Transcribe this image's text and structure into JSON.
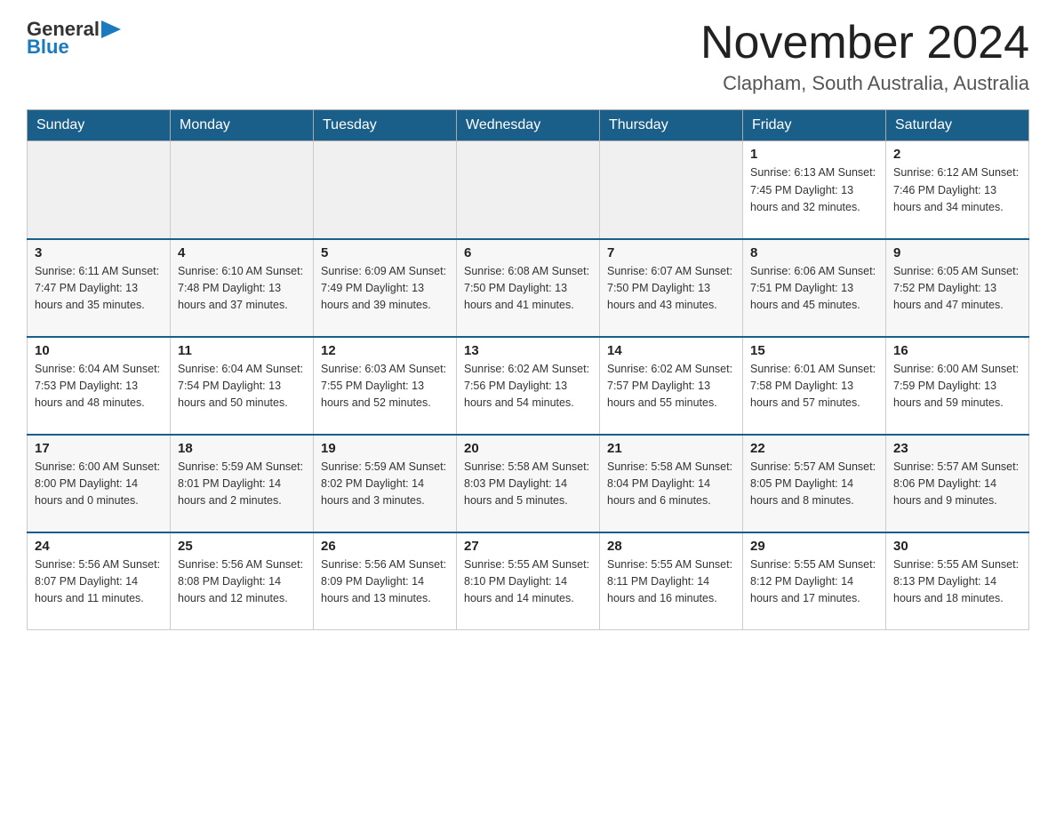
{
  "header": {
    "logo_general": "General",
    "logo_blue": "Blue",
    "title": "November 2024",
    "subtitle": "Clapham, South Australia, Australia"
  },
  "weekdays": [
    "Sunday",
    "Monday",
    "Tuesday",
    "Wednesday",
    "Thursday",
    "Friday",
    "Saturday"
  ],
  "weeks": [
    [
      {
        "day": "",
        "info": ""
      },
      {
        "day": "",
        "info": ""
      },
      {
        "day": "",
        "info": ""
      },
      {
        "day": "",
        "info": ""
      },
      {
        "day": "",
        "info": ""
      },
      {
        "day": "1",
        "info": "Sunrise: 6:13 AM\nSunset: 7:45 PM\nDaylight: 13 hours\nand 32 minutes."
      },
      {
        "day": "2",
        "info": "Sunrise: 6:12 AM\nSunset: 7:46 PM\nDaylight: 13 hours\nand 34 minutes."
      }
    ],
    [
      {
        "day": "3",
        "info": "Sunrise: 6:11 AM\nSunset: 7:47 PM\nDaylight: 13 hours\nand 35 minutes."
      },
      {
        "day": "4",
        "info": "Sunrise: 6:10 AM\nSunset: 7:48 PM\nDaylight: 13 hours\nand 37 minutes."
      },
      {
        "day": "5",
        "info": "Sunrise: 6:09 AM\nSunset: 7:49 PM\nDaylight: 13 hours\nand 39 minutes."
      },
      {
        "day": "6",
        "info": "Sunrise: 6:08 AM\nSunset: 7:50 PM\nDaylight: 13 hours\nand 41 minutes."
      },
      {
        "day": "7",
        "info": "Sunrise: 6:07 AM\nSunset: 7:50 PM\nDaylight: 13 hours\nand 43 minutes."
      },
      {
        "day": "8",
        "info": "Sunrise: 6:06 AM\nSunset: 7:51 PM\nDaylight: 13 hours\nand 45 minutes."
      },
      {
        "day": "9",
        "info": "Sunrise: 6:05 AM\nSunset: 7:52 PM\nDaylight: 13 hours\nand 47 minutes."
      }
    ],
    [
      {
        "day": "10",
        "info": "Sunrise: 6:04 AM\nSunset: 7:53 PM\nDaylight: 13 hours\nand 48 minutes."
      },
      {
        "day": "11",
        "info": "Sunrise: 6:04 AM\nSunset: 7:54 PM\nDaylight: 13 hours\nand 50 minutes."
      },
      {
        "day": "12",
        "info": "Sunrise: 6:03 AM\nSunset: 7:55 PM\nDaylight: 13 hours\nand 52 minutes."
      },
      {
        "day": "13",
        "info": "Sunrise: 6:02 AM\nSunset: 7:56 PM\nDaylight: 13 hours\nand 54 minutes."
      },
      {
        "day": "14",
        "info": "Sunrise: 6:02 AM\nSunset: 7:57 PM\nDaylight: 13 hours\nand 55 minutes."
      },
      {
        "day": "15",
        "info": "Sunrise: 6:01 AM\nSunset: 7:58 PM\nDaylight: 13 hours\nand 57 minutes."
      },
      {
        "day": "16",
        "info": "Sunrise: 6:00 AM\nSunset: 7:59 PM\nDaylight: 13 hours\nand 59 minutes."
      }
    ],
    [
      {
        "day": "17",
        "info": "Sunrise: 6:00 AM\nSunset: 8:00 PM\nDaylight: 14 hours\nand 0 minutes."
      },
      {
        "day": "18",
        "info": "Sunrise: 5:59 AM\nSunset: 8:01 PM\nDaylight: 14 hours\nand 2 minutes."
      },
      {
        "day": "19",
        "info": "Sunrise: 5:59 AM\nSunset: 8:02 PM\nDaylight: 14 hours\nand 3 minutes."
      },
      {
        "day": "20",
        "info": "Sunrise: 5:58 AM\nSunset: 8:03 PM\nDaylight: 14 hours\nand 5 minutes."
      },
      {
        "day": "21",
        "info": "Sunrise: 5:58 AM\nSunset: 8:04 PM\nDaylight: 14 hours\nand 6 minutes."
      },
      {
        "day": "22",
        "info": "Sunrise: 5:57 AM\nSunset: 8:05 PM\nDaylight: 14 hours\nand 8 minutes."
      },
      {
        "day": "23",
        "info": "Sunrise: 5:57 AM\nSunset: 8:06 PM\nDaylight: 14 hours\nand 9 minutes."
      }
    ],
    [
      {
        "day": "24",
        "info": "Sunrise: 5:56 AM\nSunset: 8:07 PM\nDaylight: 14 hours\nand 11 minutes."
      },
      {
        "day": "25",
        "info": "Sunrise: 5:56 AM\nSunset: 8:08 PM\nDaylight: 14 hours\nand 12 minutes."
      },
      {
        "day": "26",
        "info": "Sunrise: 5:56 AM\nSunset: 8:09 PM\nDaylight: 14 hours\nand 13 minutes."
      },
      {
        "day": "27",
        "info": "Sunrise: 5:55 AM\nSunset: 8:10 PM\nDaylight: 14 hours\nand 14 minutes."
      },
      {
        "day": "28",
        "info": "Sunrise: 5:55 AM\nSunset: 8:11 PM\nDaylight: 14 hours\nand 16 minutes."
      },
      {
        "day": "29",
        "info": "Sunrise: 5:55 AM\nSunset: 8:12 PM\nDaylight: 14 hours\nand 17 minutes."
      },
      {
        "day": "30",
        "info": "Sunrise: 5:55 AM\nSunset: 8:13 PM\nDaylight: 14 hours\nand 18 minutes."
      }
    ]
  ]
}
